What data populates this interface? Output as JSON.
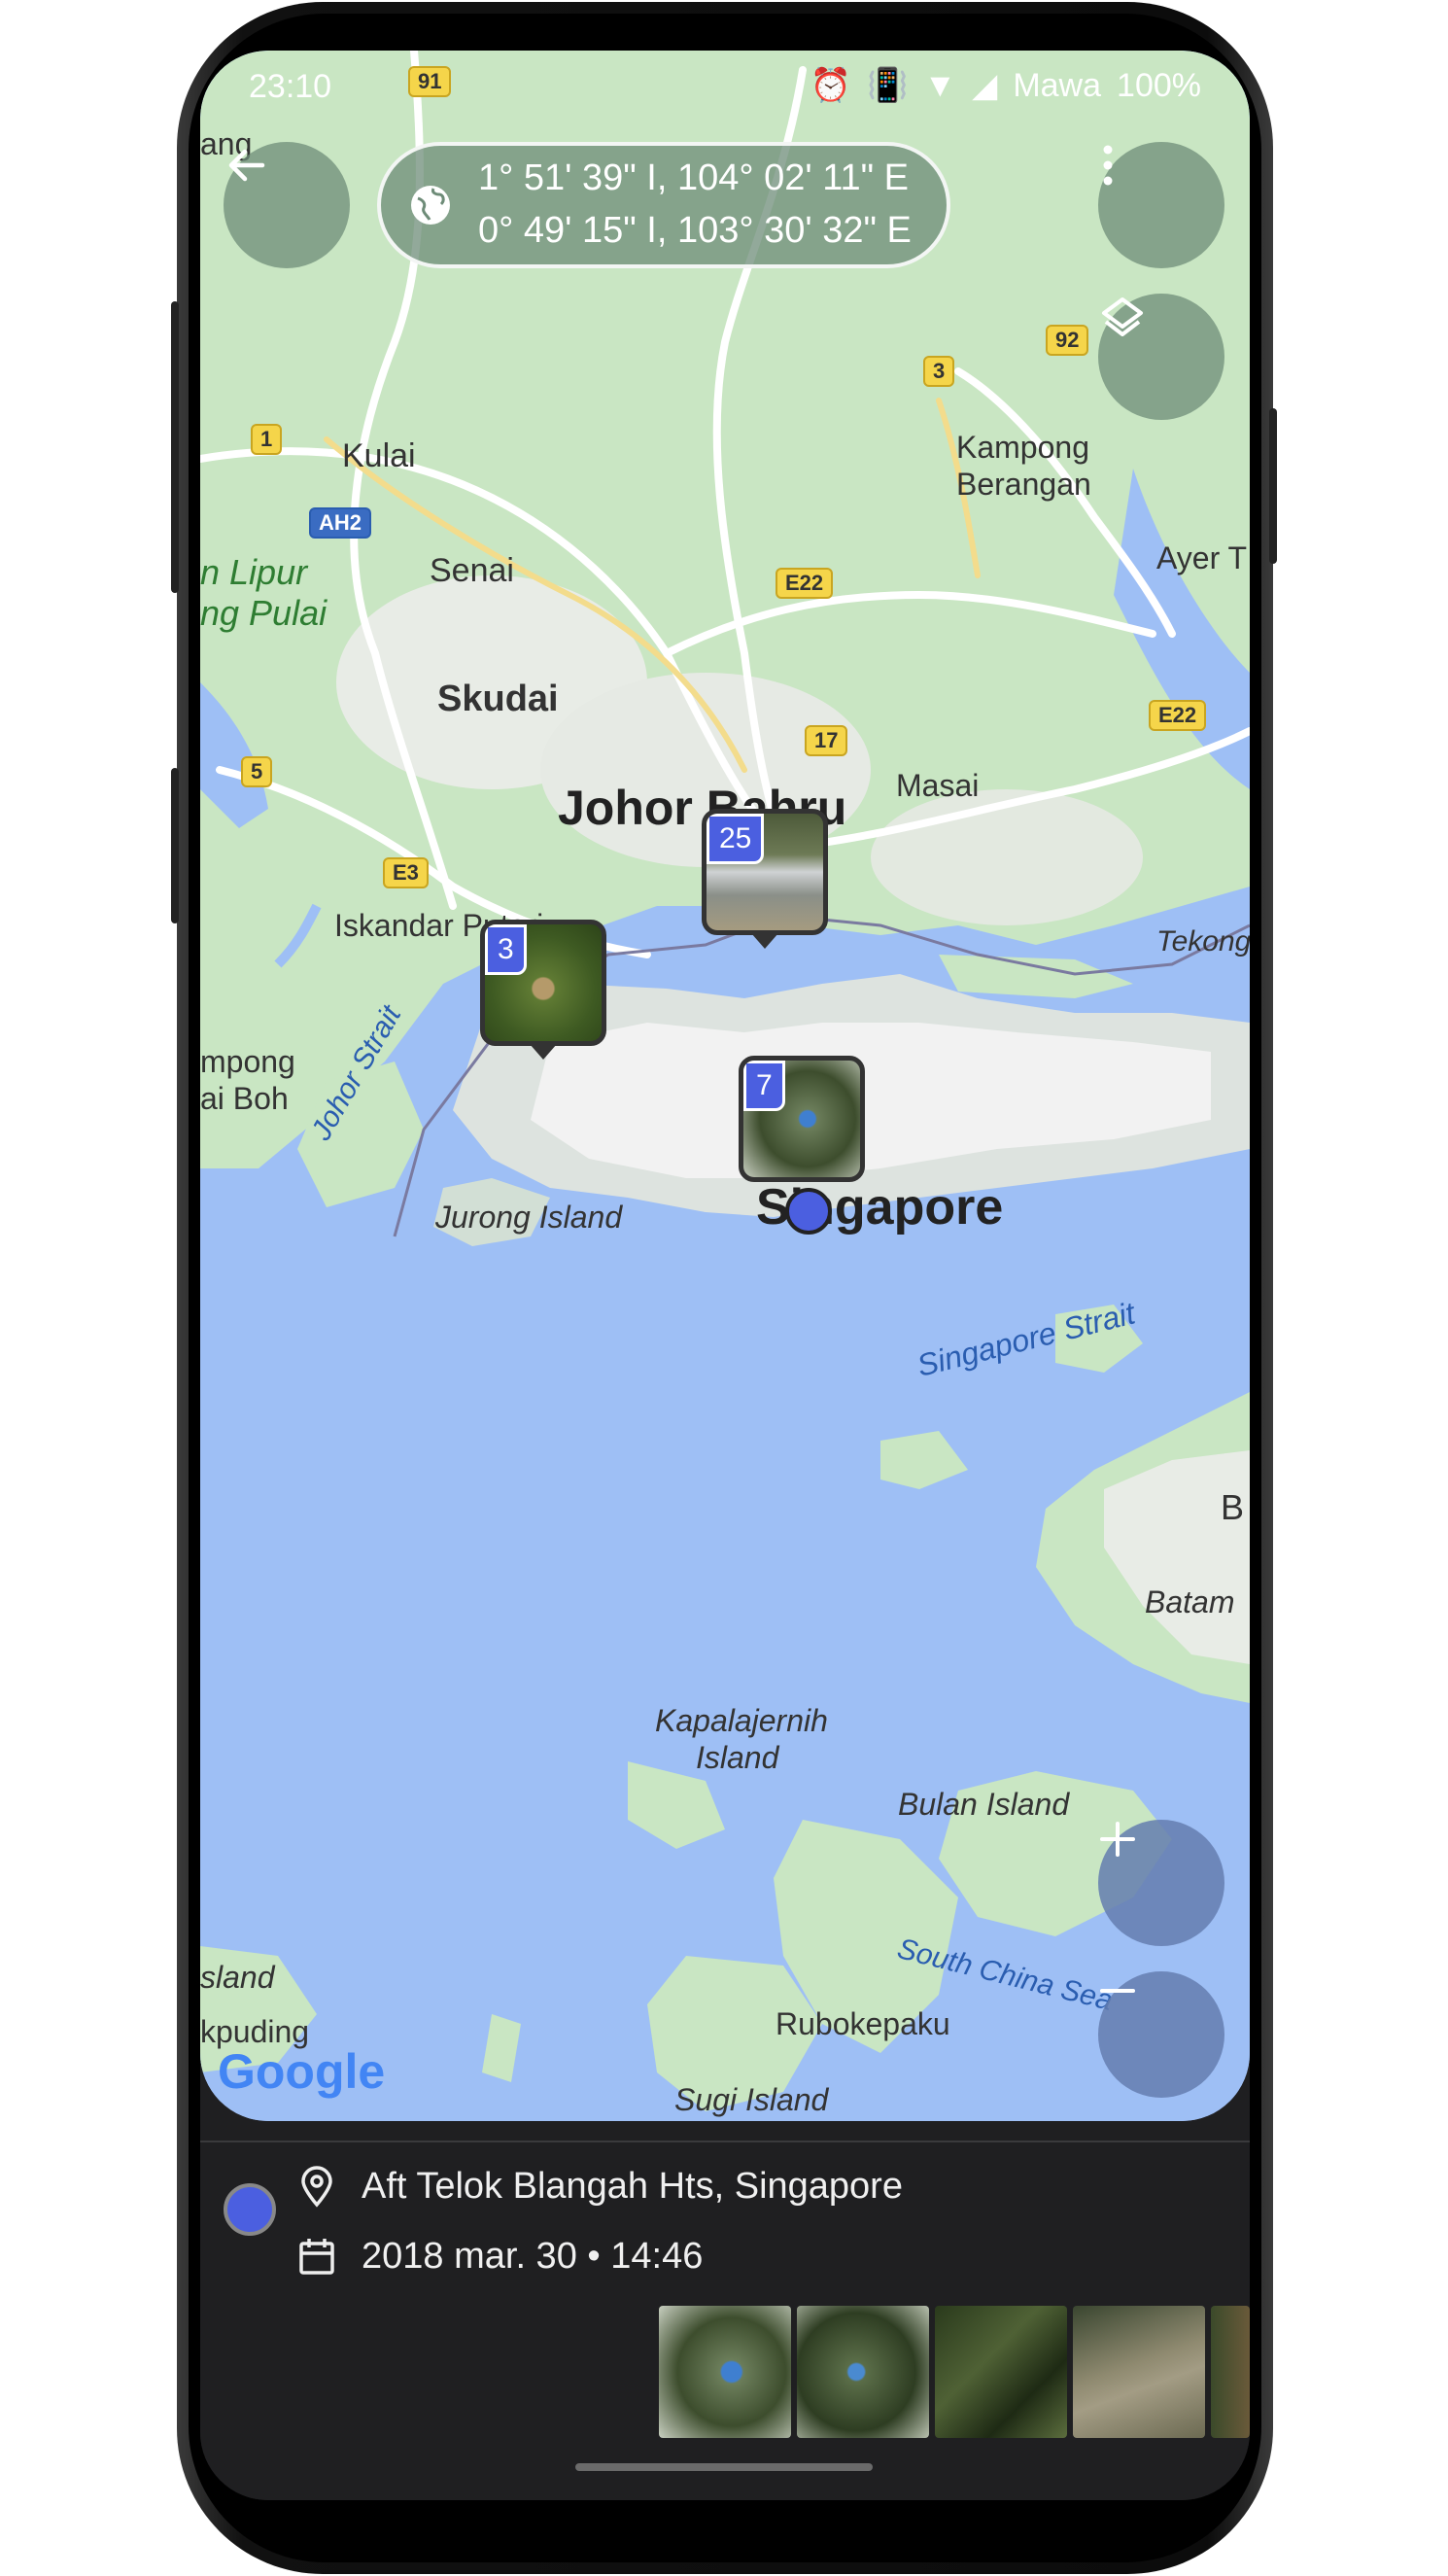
{
  "status_bar": {
    "time": "23:10",
    "carrier": "Mawa",
    "battery": "100%"
  },
  "header": {
    "coord_line_1": "1° 51' 39\" I, 104° 02' 11\" E",
    "coord_line_2": "0° 49' 15\" I, 103° 30' 32\" E"
  },
  "map": {
    "labels": {
      "kulai": "Kulai",
      "senai": "Senai",
      "skudai": "Skudai",
      "johor_bahru": "Johor Bahru",
      "masai": "Masai",
      "iskandar": "Iskandar Puteri",
      "kampong_berangan_1": "Kampong",
      "kampong_berangan_2": "Berangan",
      "ayer": "Ayer T",
      "lipur_1": "n Lipur",
      "lipur_2": "ng Pulai",
      "tekong": "Tekong",
      "kampong_boh_1": "mpong",
      "kampong_boh_2": "ai Boh",
      "johor_strait": "Johor Strait",
      "jurong": "Jurong Island",
      "singapore": "Singapore",
      "singapore_strait": "Singapore Strait",
      "batam": "Batam",
      "b_edge": "B",
      "kapalajernih_1": "Kapalajernih",
      "kapalajernih_2": "Island",
      "bulan": "Bulan Island",
      "south_china_sea": "South China Sea",
      "island_edge": "sland",
      "kpuding": "kpuding",
      "rubokepaku": "Rubokepaku",
      "sugi": "Sugi Island",
      "ang": "ang"
    },
    "shields": {
      "r91": "91",
      "r92": "92",
      "r3": "3",
      "r1": "1",
      "ah2": "AH2",
      "e22a": "E22",
      "r17": "17",
      "e22b": "E22",
      "r5": "5",
      "e3": "E3"
    },
    "clusters": {
      "c25": "25",
      "c3": "3",
      "c7": "7"
    },
    "attribution": "Google",
    "icons": {
      "back": "arrow-left-icon",
      "globe": "globe-icon",
      "menu": "more-vert-icon",
      "layers": "layers-icon",
      "zoom_in": "plus-icon",
      "zoom_out": "minus-icon"
    }
  },
  "info": {
    "location": "Aft Telok Blangah Hts, Singapore",
    "datetime": "2018 mar. 30 • 14:46"
  },
  "colors": {
    "water": "#9ebff5",
    "land": "#c9e6c3",
    "badge": "#4b5fe0",
    "bottom_panel": "#1f1f21"
  }
}
